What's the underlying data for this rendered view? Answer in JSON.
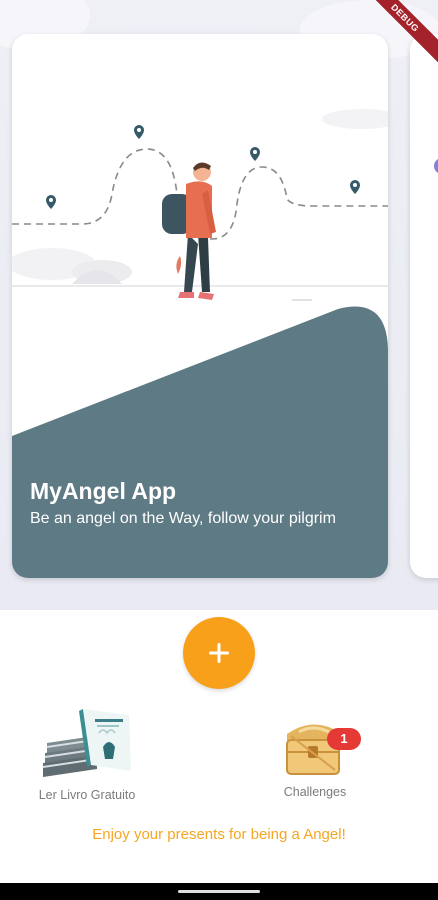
{
  "debug_banner": "DEBUG",
  "carousel": {
    "cards": [
      {
        "title": "MyAngel App",
        "subtitle": "Be an angel on the Way, follow your pilgrim"
      }
    ]
  },
  "add_button": {
    "icon": "plus-icon"
  },
  "presents": [
    {
      "label": "Ler Livro Gratuito",
      "icon": "book-stack-icon",
      "badge": null
    },
    {
      "label": "Challenges",
      "icon": "treasure-chest-icon",
      "badge": "1"
    }
  ],
  "footer_text": "Enjoy your presents for being a Angel!",
  "colors": {
    "accent": "#f9a01b",
    "card_overlay": "#5e7a85",
    "footer_text": "#f5a623",
    "badge": "#e53935"
  }
}
